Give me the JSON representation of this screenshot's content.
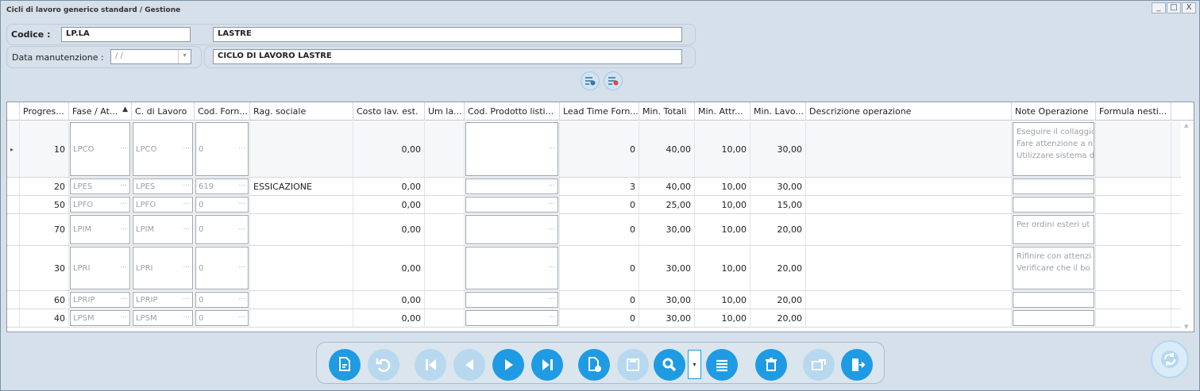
{
  "window": {
    "title": "Cicli di lavoro generico standard / Gestione",
    "min": "_",
    "max": "□",
    "close": "X"
  },
  "header": {
    "codice_label": "Codice :",
    "codice_value": "LP.LA",
    "codice_desc": "LASTRE",
    "data_label": "Data manutenzione :",
    "data_value": "/  /",
    "data_arrow": "▾",
    "ciclo_desc": "CICLO DI LAVORO LASTRE"
  },
  "grid": {
    "columns": [
      "Progres...",
      "Fase / At...",
      "C. di Lavoro",
      "Cod. Forn...",
      "Rag. sociale",
      "Costo lav. est.",
      "Um la...",
      "Cod. Prodotto listi...",
      "Lead Time Forn...",
      "Min. Totali",
      "Min. Attr...",
      "Min. Lavo...",
      "Descrizione operazione",
      "Note Operazione",
      "Formula nesti..."
    ],
    "sort_icon": "▲",
    "row_indicator": "▸",
    "rows": [
      {
        "prog": "10",
        "fase": "LPCO",
        "cdl": "LPCO",
        "forn": "0",
        "rag": "",
        "costo": "0,00",
        "lead": "0",
        "tot": "40,00",
        "attr": "10,00",
        "lav": "30,00",
        "note": [
          "Eseguire il collaggio",
          "Fare attenzione a n",
          "Utilizzare sistema d"
        ]
      },
      {
        "prog": "20",
        "fase": "LPES",
        "cdl": "LPES",
        "forn": "619",
        "rag": "ESSICAZIONE",
        "costo": "0,00",
        "lead": "3",
        "tot": "40,00",
        "attr": "10,00",
        "lav": "30,00",
        "note": []
      },
      {
        "prog": "50",
        "fase": "LPFO",
        "cdl": "LPFO",
        "forn": "0",
        "rag": "",
        "costo": "0,00",
        "lead": "0",
        "tot": "25,00",
        "attr": "10,00",
        "lav": "15,00",
        "note": []
      },
      {
        "prog": "70",
        "fase": "LPIM",
        "cdl": "LPIM",
        "forn": "0",
        "rag": "",
        "costo": "0,00",
        "lead": "0",
        "tot": "30,00",
        "attr": "10,00",
        "lav": "20,00",
        "note": [
          "Per ordini esteri ut"
        ]
      },
      {
        "prog": "30",
        "fase": "LPRI",
        "cdl": "LPRI",
        "forn": "0",
        "rag": "",
        "costo": "0,00",
        "lead": "0",
        "tot": "30,00",
        "attr": "10,00",
        "lav": "20,00",
        "note": [
          "Rifinire con attenzi",
          "Verificare che il bo"
        ]
      },
      {
        "prog": "60",
        "fase": "LPRIP",
        "cdl": "LPRIP",
        "forn": "0",
        "rag": "",
        "costo": "0,00",
        "lead": "0",
        "tot": "30,00",
        "attr": "10,00",
        "lav": "20,00",
        "note": []
      },
      {
        "prog": "40",
        "fase": "LPSM",
        "cdl": "LPSM",
        "forn": "0",
        "rag": "",
        "costo": "0,00",
        "lead": "0",
        "tot": "30,00",
        "attr": "10,00",
        "lav": "20,00",
        "note": []
      }
    ],
    "ellipsis": "···"
  },
  "toolbar": {
    "dropdown_arrow": "▾",
    "buttons": [
      {
        "name": "edit-button",
        "icon": "edit-document-icon",
        "enabled": true
      },
      {
        "name": "undo-button",
        "icon": "undo-icon",
        "enabled": false
      },
      {
        "name": "first-record-button",
        "icon": "first-icon",
        "enabled": false
      },
      {
        "name": "previous-record-button",
        "icon": "previous-icon",
        "enabled": false
      },
      {
        "name": "next-record-button",
        "icon": "next-icon",
        "enabled": true
      },
      {
        "name": "last-record-button",
        "icon": "last-icon",
        "enabled": true
      },
      {
        "name": "new-record-button",
        "icon": "new-document-icon",
        "enabled": true
      },
      {
        "name": "save-button",
        "icon": "save-icon",
        "enabled": false
      },
      {
        "name": "search-button",
        "icon": "search-icon",
        "enabled": true
      },
      {
        "name": "list-button",
        "icon": "list-icon",
        "enabled": true
      },
      {
        "name": "delete-button",
        "icon": "trash-icon",
        "enabled": true
      },
      {
        "name": "export-button",
        "icon": "export-icon",
        "enabled": false
      },
      {
        "name": "exit-button",
        "icon": "exit-icon",
        "enabled": true
      }
    ]
  },
  "colors": {
    "accent": "#1f9be3",
    "accent_disabled": "#b7d8ef",
    "window_bg": "#d6e0ea"
  }
}
